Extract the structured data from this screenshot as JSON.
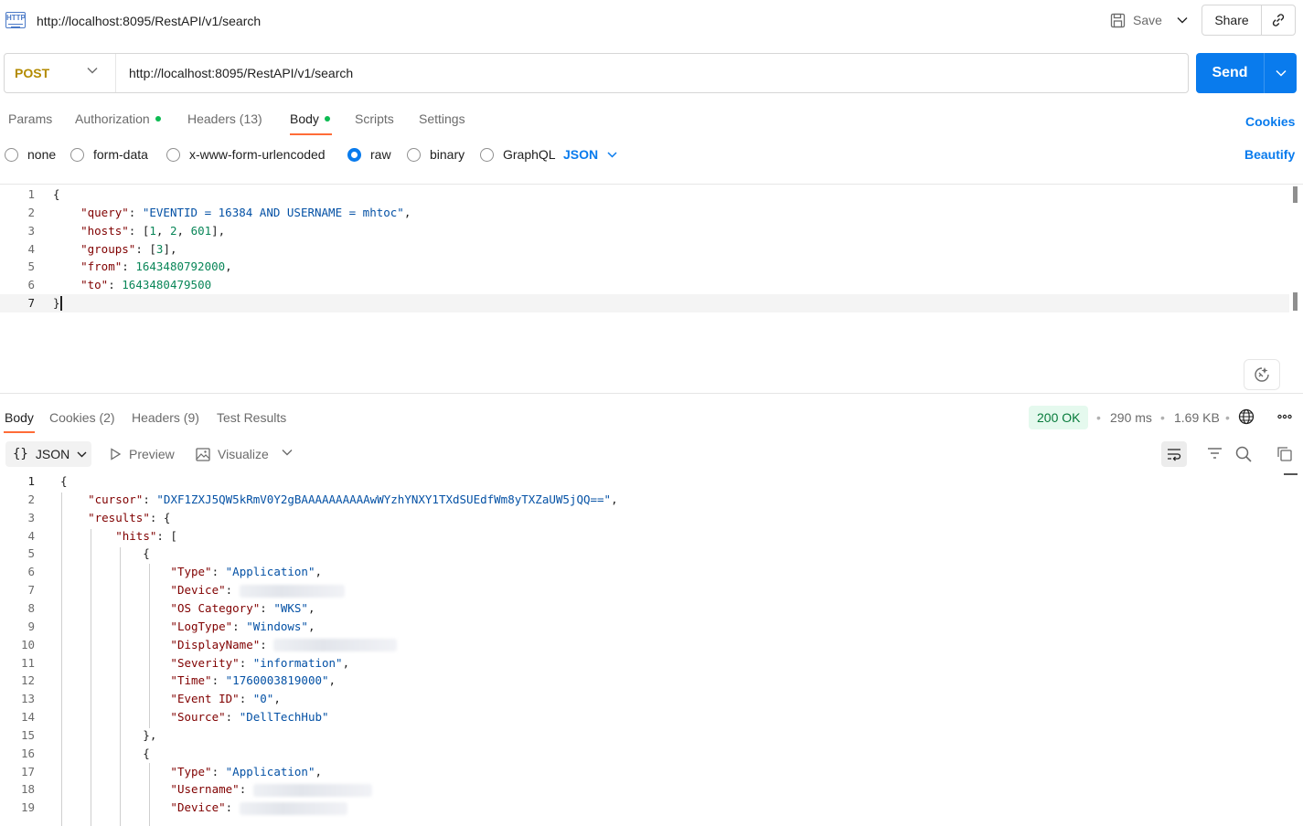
{
  "tab": {
    "title": "http://localhost:8095/RestAPI/v1/search",
    "icon": "http-icon"
  },
  "header": {
    "save_label": "Save",
    "share_label": "Share"
  },
  "request": {
    "method": "POST",
    "url": "http://localhost:8095/RestAPI/v1/search",
    "send_label": "Send"
  },
  "req_tabs": {
    "params": "Params",
    "authorization": "Authorization",
    "headers": "Headers (13)",
    "body": "Body",
    "scripts": "Scripts",
    "settings": "Settings",
    "cookies": "Cookies",
    "active": "Body"
  },
  "body_types": {
    "none": "none",
    "form_data": "form-data",
    "urlencoded": "x-www-form-urlencoded",
    "raw": "raw",
    "binary": "binary",
    "graphql": "GraphQL",
    "format": "JSON",
    "selected": "raw",
    "beautify": "Beautify"
  },
  "request_body": [
    {
      "n": "1",
      "tokens": [
        {
          "t": "{",
          "c": "pun"
        }
      ]
    },
    {
      "n": "2",
      "tokens": [
        {
          "t": "    ",
          "c": "pun"
        },
        {
          "t": "\"query\"",
          "c": "key"
        },
        {
          "t": ": ",
          "c": "pun"
        },
        {
          "t": "\"EVENTID = 16384 AND USERNAME = mhtoc\"",
          "c": "str"
        },
        {
          "t": ",",
          "c": "pun"
        }
      ]
    },
    {
      "n": "3",
      "tokens": [
        {
          "t": "    ",
          "c": "pun"
        },
        {
          "t": "\"hosts\"",
          "c": "key"
        },
        {
          "t": ": [",
          "c": "pun"
        },
        {
          "t": "1",
          "c": "num"
        },
        {
          "t": ", ",
          "c": "pun"
        },
        {
          "t": "2",
          "c": "num"
        },
        {
          "t": ", ",
          "c": "pun"
        },
        {
          "t": "601",
          "c": "num"
        },
        {
          "t": "],",
          "c": "pun"
        }
      ]
    },
    {
      "n": "4",
      "tokens": [
        {
          "t": "    ",
          "c": "pun"
        },
        {
          "t": "\"groups\"",
          "c": "key"
        },
        {
          "t": ": [",
          "c": "pun"
        },
        {
          "t": "3",
          "c": "num"
        },
        {
          "t": "],",
          "c": "pun"
        }
      ]
    },
    {
      "n": "5",
      "tokens": [
        {
          "t": "    ",
          "c": "pun"
        },
        {
          "t": "\"from\"",
          "c": "key"
        },
        {
          "t": ": ",
          "c": "pun"
        },
        {
          "t": "1643480792000",
          "c": "num"
        },
        {
          "t": ",",
          "c": "pun"
        }
      ]
    },
    {
      "n": "6",
      "tokens": [
        {
          "t": "    ",
          "c": "pun"
        },
        {
          "t": "\"to\"",
          "c": "key"
        },
        {
          "t": ": ",
          "c": "pun"
        },
        {
          "t": "1643480479500",
          "c": "num"
        }
      ]
    },
    {
      "n": "7",
      "tokens": [
        {
          "t": "}",
          "c": "pun"
        }
      ]
    }
  ],
  "resp_tabs": {
    "body": "Body",
    "cookies": "Cookies (2)",
    "headers": "Headers (9)",
    "tests": "Test Results",
    "active": "Body"
  },
  "response_meta": {
    "status": "200 OK",
    "time": "290 ms",
    "size": "1.69 KB",
    "status_color": "#067a3a"
  },
  "resp_toolbar": {
    "format_icon": "{}",
    "format": "JSON",
    "preview": "Preview",
    "visualize": "Visualize"
  },
  "response_body": [
    {
      "n": "1",
      "tokens": [
        {
          "t": "{",
          "c": "pun"
        }
      ]
    },
    {
      "n": "2",
      "tokens": [
        {
          "t": "    ",
          "c": "pun"
        },
        {
          "t": "\"cursor\"",
          "c": "key"
        },
        {
          "t": ": ",
          "c": "pun"
        },
        {
          "t": "\"DXF1ZXJ5QW5kRmV0Y2gBAAAAAAAAAAwWYzhYNXY1TXdSUEdfWm8yTXZaUW5jQQ==\"",
          "c": "str"
        },
        {
          "t": ",",
          "c": "pun"
        }
      ]
    },
    {
      "n": "3",
      "tokens": [
        {
          "t": "    ",
          "c": "pun"
        },
        {
          "t": "\"results\"",
          "c": "key"
        },
        {
          "t": ": {",
          "c": "pun"
        }
      ]
    },
    {
      "n": "4",
      "tokens": [
        {
          "t": "        ",
          "c": "pun"
        },
        {
          "t": "\"hits\"",
          "c": "key"
        },
        {
          "t": ": [",
          "c": "pun"
        }
      ]
    },
    {
      "n": "5",
      "tokens": [
        {
          "t": "            {",
          "c": "pun"
        }
      ]
    },
    {
      "n": "6",
      "tokens": [
        {
          "t": "                ",
          "c": "pun"
        },
        {
          "t": "\"Type\"",
          "c": "key"
        },
        {
          "t": ": ",
          "c": "pun"
        },
        {
          "t": "\"Application\"",
          "c": "str"
        },
        {
          "t": ",",
          "c": "pun"
        }
      ]
    },
    {
      "n": "7",
      "tokens": [
        {
          "t": "                ",
          "c": "pun"
        },
        {
          "t": "\"Device\"",
          "c": "key"
        },
        {
          "t": ": ",
          "c": "pun"
        },
        {
          "t": "",
          "c": "redact",
          "w": 115
        }
      ]
    },
    {
      "n": "8",
      "tokens": [
        {
          "t": "                ",
          "c": "pun"
        },
        {
          "t": "\"OS Category\"",
          "c": "key"
        },
        {
          "t": ": ",
          "c": "pun"
        },
        {
          "t": "\"WKS\"",
          "c": "str"
        },
        {
          "t": ",",
          "c": "pun"
        }
      ]
    },
    {
      "n": "9",
      "tokens": [
        {
          "t": "                ",
          "c": "pun"
        },
        {
          "t": "\"LogType\"",
          "c": "key"
        },
        {
          "t": ": ",
          "c": "pun"
        },
        {
          "t": "\"Windows\"",
          "c": "str"
        },
        {
          "t": ",",
          "c": "pun"
        }
      ]
    },
    {
      "n": "10",
      "tokens": [
        {
          "t": "                ",
          "c": "pun"
        },
        {
          "t": "\"DisplayName\"",
          "c": "key"
        },
        {
          "t": ": ",
          "c": "pun"
        },
        {
          "t": "",
          "c": "redact",
          "w": 135
        }
      ]
    },
    {
      "n": "11",
      "tokens": [
        {
          "t": "                ",
          "c": "pun"
        },
        {
          "t": "\"Severity\"",
          "c": "key"
        },
        {
          "t": ": ",
          "c": "pun"
        },
        {
          "t": "\"information\"",
          "c": "str"
        },
        {
          "t": ",",
          "c": "pun"
        }
      ]
    },
    {
      "n": "12",
      "tokens": [
        {
          "t": "                ",
          "c": "pun"
        },
        {
          "t": "\"Time\"",
          "c": "key"
        },
        {
          "t": ": ",
          "c": "pun"
        },
        {
          "t": "\"1760003819000\"",
          "c": "str"
        },
        {
          "t": ",",
          "c": "pun"
        }
      ]
    },
    {
      "n": "13",
      "tokens": [
        {
          "t": "                ",
          "c": "pun"
        },
        {
          "t": "\"Event ID\"",
          "c": "key"
        },
        {
          "t": ": ",
          "c": "pun"
        },
        {
          "t": "\"0\"",
          "c": "str"
        },
        {
          "t": ",",
          "c": "pun"
        }
      ]
    },
    {
      "n": "14",
      "tokens": [
        {
          "t": "                ",
          "c": "pun"
        },
        {
          "t": "\"Source\"",
          "c": "key"
        },
        {
          "t": ": ",
          "c": "pun"
        },
        {
          "t": "\"DellTechHub\"",
          "c": "str"
        }
      ]
    },
    {
      "n": "15",
      "tokens": [
        {
          "t": "            },",
          "c": "pun"
        }
      ]
    },
    {
      "n": "16",
      "tokens": [
        {
          "t": "            {",
          "c": "pun"
        }
      ]
    },
    {
      "n": "17",
      "tokens": [
        {
          "t": "                ",
          "c": "pun"
        },
        {
          "t": "\"Type\"",
          "c": "key"
        },
        {
          "t": ": ",
          "c": "pun"
        },
        {
          "t": "\"Application\"",
          "c": "str"
        },
        {
          "t": ",",
          "c": "pun"
        }
      ]
    },
    {
      "n": "18",
      "tokens": [
        {
          "t": "                ",
          "c": "pun"
        },
        {
          "t": "\"Username\"",
          "c": "key"
        },
        {
          "t": ": ",
          "c": "pun"
        },
        {
          "t": "",
          "c": "redact",
          "w": 130
        }
      ]
    },
    {
      "n": "19",
      "tokens": [
        {
          "t": "                ",
          "c": "pun"
        },
        {
          "t": "\"Device\"",
          "c": "key"
        },
        {
          "t": ": ",
          "c": "pun"
        },
        {
          "t": "",
          "c": "redact",
          "w": 118
        }
      ]
    }
  ]
}
